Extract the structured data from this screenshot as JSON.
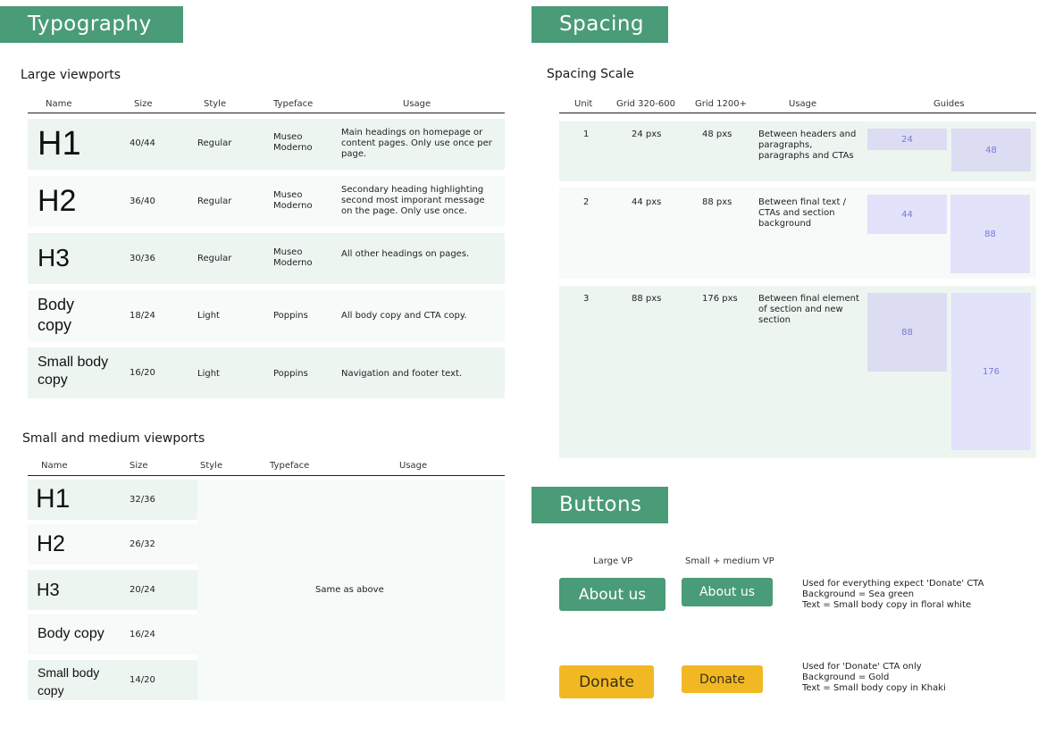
{
  "typography": {
    "title": "Typography",
    "large": {
      "subtitle": "Large viewports",
      "headers": [
        "Name",
        "Size",
        "Style",
        "Typeface",
        "Usage"
      ],
      "rows": [
        {
          "name": "H1",
          "size": "40/44",
          "style": "Regular",
          "typeface": "Museo Moderno",
          "usage": "Main headings on homepage or content pages. Only use once per page."
        },
        {
          "name": "H2",
          "size": "36/40",
          "style": "Regular",
          "typeface": "Museo Moderno",
          "usage": "Secondary heading highlighting second most imporant message on the page. Only use once."
        },
        {
          "name": "H3",
          "size": "30/36",
          "style": "Regular",
          "typeface": "Museo Moderno",
          "usage": "All other headings on pages."
        },
        {
          "name": "Body copy",
          "size": "18/24",
          "style": "Light",
          "typeface": "Poppins",
          "usage": "All body copy and CTA copy."
        },
        {
          "name": "Small body copy",
          "size": "16/20",
          "style": "Light",
          "typeface": "Poppins",
          "usage": "Navigation and footer text."
        }
      ]
    },
    "small": {
      "subtitle": "Small and medium viewports",
      "headers": [
        "Name",
        "Size",
        "Style",
        "Typeface",
        "Usage"
      ],
      "same_as_above": "Same as above",
      "rows": [
        {
          "name": "H1",
          "size": "32/36"
        },
        {
          "name": "H2",
          "size": "26/32"
        },
        {
          "name": "H3",
          "size": "20/24"
        },
        {
          "name": "Body copy",
          "size": "16/24"
        },
        {
          "name": "Small body copy",
          "size": "14/20"
        }
      ]
    }
  },
  "spacing": {
    "title": "Spacing",
    "subtitle": "Spacing Scale",
    "headers": [
      "Unit",
      "Grid 320-600",
      "Grid 1200+",
      "Usage",
      "Guides"
    ],
    "rows": [
      {
        "unit": "1",
        "grid_small": "24 pxs",
        "grid_large": "48 pxs",
        "usage": "Between headers and paragraphs, paragraphs and CTAs",
        "guide_small": "24",
        "guide_large": "48"
      },
      {
        "unit": "2",
        "grid_small": "44 pxs",
        "grid_large": "88 pxs",
        "usage": "Between final text / CTAs and section background",
        "guide_small": "44",
        "guide_large": "88"
      },
      {
        "unit": "3",
        "grid_small": "88 pxs",
        "grid_large": "176 pxs",
        "usage": "Between final element of section and new section",
        "guide_small": "88",
        "guide_large": "176"
      }
    ]
  },
  "buttons": {
    "title": "Buttons",
    "col_large": "Large VP",
    "col_small": "Small + medium VP",
    "rows": [
      {
        "label": "About us",
        "notes": [
          "Used for everything expect 'Donate' CTA",
          "Background = Sea green",
          "Text = Small body copy in floral white"
        ]
      },
      {
        "label": "Donate",
        "notes": [
          "Used for 'Donate' CTA only",
          "Background = Gold",
          "Text = Small body copy in Khaki"
        ]
      }
    ]
  },
  "colors": {
    "sea_green": "#4a9b78",
    "gold": "#f2b824",
    "guide_purple": "#dcdcf3"
  }
}
